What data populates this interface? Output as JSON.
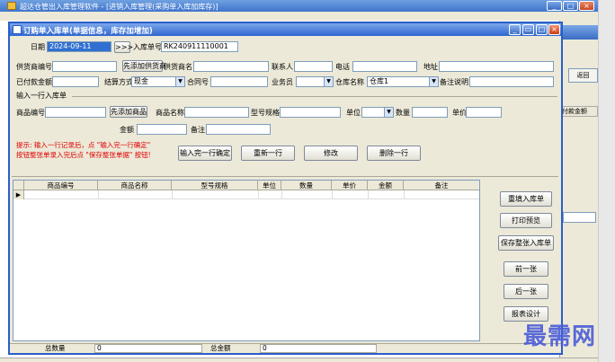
{
  "background_window": {
    "title": "超达仓管出入库管理软件 - [进销入库管理(采购单入库加库存)]",
    "menu_items": [],
    "return_label": "返回",
    "column_label": "付款金额"
  },
  "dialog": {
    "title": "订购单入库单(单据信息，库存加增加)",
    "row1": {
      "date_label": "日期",
      "date_value": "2024-09-11",
      "arrow_label": ">>>",
      "doc_no_label": "入库单号",
      "doc_no_value": "RK240911110001"
    },
    "row2": {
      "supplier_code_label": "供货商编号",
      "add_supplier_button": "先添加供货商",
      "supplier_name_label": "供货商名",
      "contact_label": "联系人",
      "phone_label": "电话",
      "address_label": "地址"
    },
    "row3": {
      "paid_label": "已付款金额",
      "settle_label": "结算方式",
      "settle_value": "现金",
      "contract_label": "合同号",
      "salesman_label": "业务员",
      "warehouse_label": "仓库名称",
      "warehouse_value": "仓库1",
      "remark_label": "备注说明"
    },
    "section_label": "输入一行入库单",
    "row4": {
      "product_code_label": "商品编号",
      "add_product_button": "先添加商品",
      "product_name_label": "商品名称",
      "model_label": "型号规格",
      "unit_label": "单位",
      "qty_label": "数量",
      "price_label": "单价"
    },
    "row5": {
      "amount_label": "金额",
      "note_label": "备注"
    },
    "hint_line1": "提示: 输入一行记录后，点 \"输入完一行确定\"",
    "hint_line2": "按钮整张单录入完后点 \"保存整张单据\" 按钮!",
    "action_buttons": {
      "confirm_row": "输入完一行确定",
      "modify_row": "重新一行",
      "edit": "修改",
      "delete_row": "删除一行"
    },
    "grid": {
      "headers": [
        "商品编号",
        "商品名称",
        "型号规格",
        "单位",
        "数量",
        "单价",
        "金额",
        "备注"
      ],
      "row_indicator": "▶"
    },
    "side_buttons": {
      "refill": "重填入库单",
      "print_preview": "打印预览",
      "save_all": "保存整张入库单",
      "prev": "前一张",
      "next": "后一张",
      "report_design": "报表设计"
    },
    "status": {
      "total_qty_label": "总数量",
      "total_qty_value": "0",
      "total_amount_label": "总金额",
      "total_amount_value": "0"
    }
  },
  "watermark": "最需网"
}
